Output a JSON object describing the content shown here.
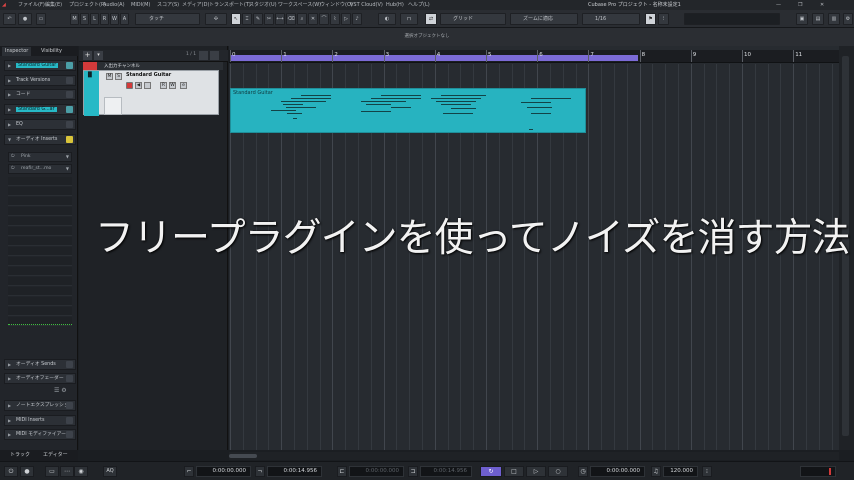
{
  "app": {
    "title": "Cubase Pro プロジェクト - 名称未設定1"
  },
  "menu": {
    "items": [
      "ファイル(F)",
      "編集(E)",
      "プロジェクト(P)",
      "Audio(A)",
      "MIDI(M)",
      "スコア(S)",
      "メディア(D)",
      "トランスポート(T)",
      "スタジオ(U)",
      "ワークスペース(W)",
      "ウィンドウ(O)",
      "VST Cloud(V)",
      "Hub(H)",
      "ヘルプ(L)"
    ]
  },
  "toolbar": {
    "mode_buttons": [
      "M",
      "S",
      "L",
      "R",
      "W",
      "A"
    ],
    "automation_mode": "タッチ",
    "grid_type": "グリッド",
    "zoom_mode": "ズームに適応",
    "quantize": "1/16"
  },
  "info_line": {
    "text": "選択オブジェクトなし"
  },
  "inspector": {
    "tabs": [
      "Inspector",
      "Visibility"
    ],
    "track_name": "Standard Guitar",
    "sections": [
      "Track Versions",
      "コード"
    ],
    "section_track_short": "Standard G...ar",
    "eq": "EQ",
    "inserts_label": "オーディオ Inserts",
    "inserts": [
      "Pink",
      "reafir_st...mo"
    ],
    "sends_label": "オーディオ Sends",
    "fader_label": "オーディオフェーダー",
    "note_expression": "ノートエクスプレッション",
    "midi_inserts": "MIDI Inserts",
    "midi_modifiers": "MIDI モディファイアー",
    "bottom_tabs": [
      "トラック",
      "エディター"
    ]
  },
  "tracklist": {
    "counter": "1 / 1",
    "folder_name": "入出力チャンネル",
    "track_name": "Standard Guitar",
    "track_buttons": [
      "M",
      "S",
      "R",
      "W",
      "e"
    ]
  },
  "ruler": {
    "numbers": [
      "0",
      "1",
      "2",
      "3",
      "4",
      "5",
      "6",
      "7",
      "8",
      "9",
      "10",
      "11"
    ]
  },
  "event": {
    "name": "Standard Guitar"
  },
  "overlay": {
    "caption": "フリープラグインを使ってノイズを消す方法"
  },
  "transport": {
    "position_left": "0:00:00.000",
    "position_right": "0:00:14.956",
    "punch_in": "0:00:00.000",
    "punch_out": "0:00:14.956",
    "main_position": "0:00:00.000",
    "tempo": "120.000",
    "aq_label": "AQ"
  },
  "colors": {
    "track_teal": "#27b9c6",
    "loop_purple": "#7c6bd6",
    "record_red": "#d23a3a"
  }
}
